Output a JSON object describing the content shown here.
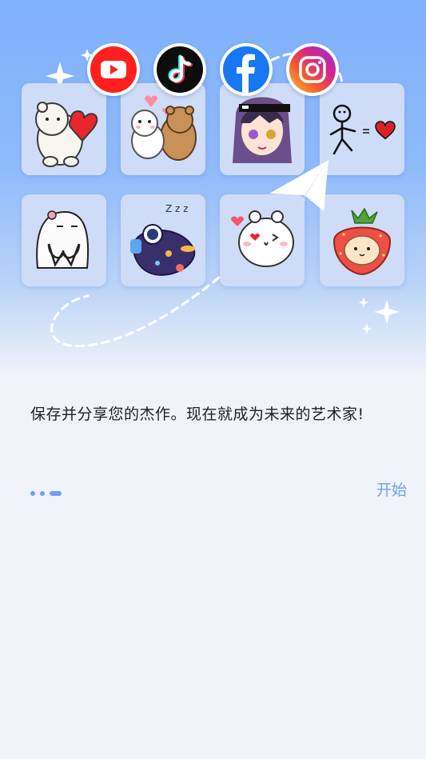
{
  "onboarding": {
    "message": "保存并分享您的杰作。现在就成为未来的艺术家!",
    "start_label": "开始",
    "page_index": 3,
    "page_count": 3
  },
  "social_icons": [
    "youtube-icon",
    "tiktok-icon",
    "facebook-icon",
    "instagram-icon"
  ],
  "stickers": [
    "polar-bear-heart-sticker",
    "hugging-bears-sticker",
    "anime-girl-sunglasses-sticker",
    "stick-figure-heart-sticker",
    "ghost-heart-sticker",
    "astronaut-sleeping-sticker",
    "white-blob-kiss-sticker",
    "strawberry-cat-sticker"
  ],
  "colors": {
    "accent": "#6f9ff0",
    "hero_top": "#7fb0fb",
    "tile_bg": "#cfdcf7",
    "page_bg": "#f0f3f9"
  }
}
